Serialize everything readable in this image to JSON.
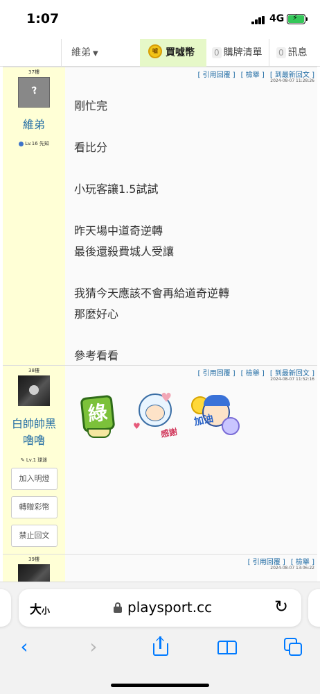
{
  "status": {
    "time": "1:07",
    "network": "4G"
  },
  "nav": {
    "user": "維弟",
    "buy": "買噓幣",
    "buy_coin_text": "噓",
    "cart_count": "0",
    "cart": "購牌清單",
    "msg_count": "0",
    "msg": "訊息"
  },
  "posts": [
    {
      "floor": "37樓",
      "username": "維弟",
      "level": "Lv.16 先知",
      "actions": [
        "[ 引用回覆 ]",
        "[ 檢舉 ]",
        "[ 到最新回文 ]"
      ],
      "timestamp": "2024-08-07 11:28:26",
      "lines": [
        "剛忙完",
        "看比分",
        "小玩客讓1.5試試",
        "昨天場中道奇逆轉",
        "最後還殺費城人受讓",
        "我猜今天應該不會再給道奇逆轉",
        "那麼好心",
        "參考看看"
      ]
    },
    {
      "floor": "38樓",
      "username": [
        "白帥帥黑",
        "嚕嚕"
      ],
      "level": "✎ Lv.1 球迷",
      "actions": [
        "[ 引用回覆 ]",
        "[ 檢舉 ]",
        "[ 到最新回文 ]"
      ],
      "timestamp": "2024-08-07 11:52:16",
      "buttons": [
        "加入明燈",
        "轉贈彩幣",
        "禁止回文"
      ],
      "stickers": {
        "green": "綠",
        "thanks": "感謝",
        "cheer": "加油"
      }
    },
    {
      "floor": "39樓",
      "actions": [
        "[ 引用回覆 ]",
        "[ 檢舉 ]"
      ],
      "timestamp": "2024-08-07 13:06:22"
    }
  ],
  "browser": {
    "text_size": "大",
    "text_size_small": "小",
    "url": "playsport.cc"
  },
  "colors": {
    "accent": "#007aff",
    "username": "#1e6aa3",
    "sidebar": "#ffffd6",
    "buy_bg": "#e6f8c8"
  }
}
